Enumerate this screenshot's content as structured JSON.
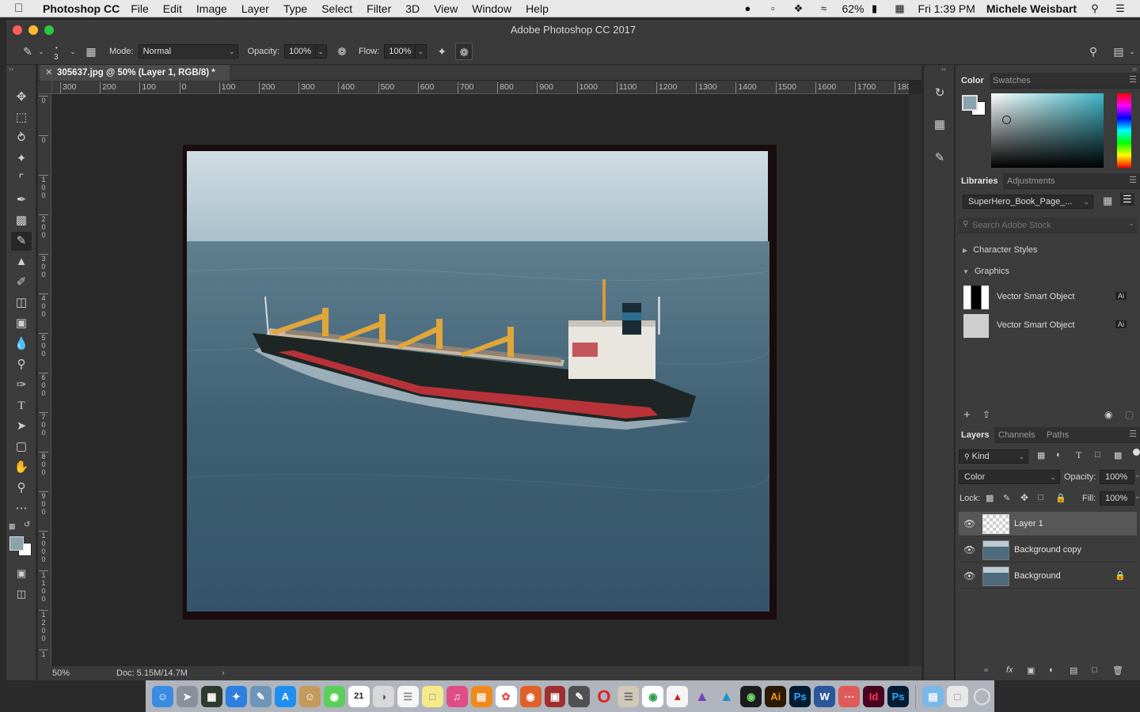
{
  "menubar": {
    "app": "Photoshop CC",
    "menus": [
      "File",
      "Edit",
      "Image",
      "Layer",
      "Type",
      "Select",
      "Filter",
      "3D",
      "View",
      "Window",
      "Help"
    ],
    "battery": "62%",
    "clock": "Fri 1:39 PM",
    "user": "Michele Weisbart"
  },
  "window": {
    "title": "Adobe Photoshop CC 2017"
  },
  "options": {
    "brush_size": "3",
    "mode_label": "Mode:",
    "mode_value": "Normal",
    "opacity_label": "Opacity:",
    "opacity_value": "100%",
    "flow_label": "Flow:",
    "flow_value": "100%"
  },
  "document": {
    "tab_title": "305637.jpg @ 50% (Layer 1, RGB/8) *",
    "zoom": "50%",
    "doc_size": "Doc: 5.15M/14.7M",
    "ruler_h": [
      "300",
      "200",
      "100",
      "0",
      "100",
      "200",
      "300",
      "400",
      "500",
      "600",
      "700",
      "800",
      "900",
      "1000",
      "1100",
      "1200",
      "1300",
      "1400",
      "1500",
      "1600",
      "1700",
      "180"
    ],
    "ruler_v": [
      "0",
      "0",
      "1\n0\n0",
      "2\n0\n0",
      "3\n0\n0",
      "4\n0\n0",
      "5\n0\n0",
      "6\n0\n0",
      "7\n0\n0",
      "8\n0\n0",
      "9\n0\n0",
      "1\n0\n0\n0",
      "1\n1\n0\n0",
      "1\n2\n0\n0",
      "1"
    ]
  },
  "color_panel": {
    "tabs": [
      "Color",
      "Swatches"
    ]
  },
  "libraries_panel": {
    "tabs": [
      "Libraries",
      "Adjustments"
    ],
    "library_name": "SuperHero_Book_Page_...",
    "search_placeholder": "Search Adobe Stock",
    "section_character_styles": "Character Styles",
    "section_graphics": "Graphics",
    "graphics": [
      {
        "name": "Vector Smart Object",
        "badge": "Ai"
      },
      {
        "name": "Vector Smart Object",
        "badge": "Ai"
      }
    ]
  },
  "layers_panel": {
    "tabs": [
      "Layers",
      "Channels",
      "Paths"
    ],
    "filter_kind": "Kind",
    "blend_mode": "Color",
    "opacity_label": "Opacity:",
    "opacity_value": "100%",
    "lock_label": "Lock:",
    "fill_label": "Fill:",
    "fill_value": "100%",
    "layers": [
      {
        "name": "Layer 1",
        "selected": true,
        "locked": false
      },
      {
        "name": "Background copy",
        "selected": false,
        "locked": false
      },
      {
        "name": "Background",
        "selected": false,
        "locked": true
      }
    ]
  },
  "dock": {
    "ai": "Ai",
    "ps": "Ps",
    "word": "W",
    "id": "Id",
    "ps2": "Ps",
    "calendar_day": "21"
  },
  "colors": {
    "ui_bg": "#3c3c3c",
    "foreground_swatch": "#8aa3ad",
    "color_field": "#3fb7c7"
  }
}
